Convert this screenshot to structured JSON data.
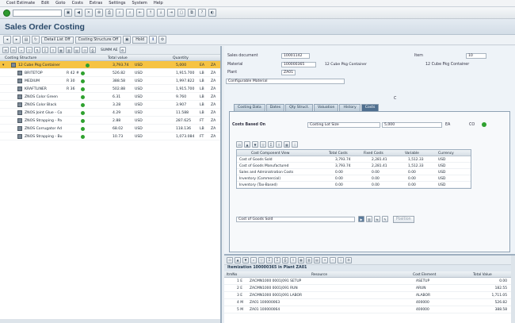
{
  "menu": [
    "Cost Estimate",
    "Edit",
    "Goto",
    "Costs",
    "Extras",
    "Settings",
    "System",
    "Help"
  ],
  "window_title": "Sales Order Costing",
  "app_buttons": {
    "detail_list_off": "Detail List Off",
    "costing_structure_off": "Costing Structure Off",
    "hold": "Hold"
  },
  "tree": {
    "summary_label": "SUMM AE",
    "headers": {
      "structure": "Costing Structure",
      "total_value": "Total value",
      "quantity": "Quantity"
    },
    "rows": [
      {
        "name": "12 Cube Pkg Container",
        "qty_prefix": "",
        "value": "3,793.74",
        "cur": "USD",
        "quantity": "5,000",
        "unit": "EA",
        "trail": "ZA",
        "selected": true
      },
      {
        "name": "BRITETOP",
        "qty_prefix": "R 42 #",
        "value": "526.82",
        "cur": "USD",
        "quantity": "1,915.700",
        "unit": "LB",
        "trail": "ZA",
        "selected": false
      },
      {
        "name": "MEDIUM",
        "qty_prefix": "R 30",
        "value": "388.58",
        "cur": "USD",
        "quantity": "1,997.822",
        "unit": "LB",
        "trail": "ZA",
        "selected": false
      },
      {
        "name": "KRAFTLINER",
        "qty_prefix": "R 36",
        "value": "502.88",
        "cur": "USD",
        "quantity": "1,915.700",
        "unit": "LB",
        "trail": "ZA",
        "selected": false
      },
      {
        "name": "ZNOS Color Green",
        "qty_prefix": "",
        "value": "6.31",
        "cur": "USD",
        "quantity": "9.760",
        "unit": "LB",
        "trail": "ZA",
        "selected": false
      },
      {
        "name": "ZNOS Color Black",
        "qty_prefix": "",
        "value": "3.28",
        "cur": "USD",
        "quantity": "3.907",
        "unit": "LB",
        "trail": "ZA",
        "selected": false
      },
      {
        "name": "ZNOS Joint Glue - Co",
        "qty_prefix": "",
        "value": "4.29",
        "cur": "USD",
        "quantity": "11.588",
        "unit": "LB",
        "trail": "ZA",
        "selected": false
      },
      {
        "name": "ZNOS Strapping - Pa",
        "qty_prefix": "",
        "value": "2.88",
        "cur": "USD",
        "quantity": "287.625",
        "unit": "FT",
        "trail": "ZA",
        "selected": false
      },
      {
        "name": "ZNOS Corrugator Ad",
        "qty_prefix": "",
        "value": "68.02",
        "cur": "USD",
        "quantity": "118.136",
        "unit": "LB",
        "trail": "ZA",
        "selected": false
      },
      {
        "name": "ZNOS Strapping - Bu",
        "qty_prefix": "",
        "value": "10.73",
        "cur": "USD",
        "quantity": "1,073.084",
        "unit": "FT",
        "trail": "ZA",
        "selected": false
      }
    ]
  },
  "header_fields": {
    "sales_document_label": "Sales document",
    "sales_document_value": "10001142",
    "item_label": "Item",
    "item_value": "10",
    "material_label": "Material",
    "material_value": "100000365",
    "material_desc": "12 Cube Pkg Container",
    "plant_label": "Plant",
    "plant_value": "ZA01",
    "configurable": "Configurable Material"
  },
  "tabs": [
    "Costing Data",
    "Dates",
    "Qty Struct.",
    "Valuation",
    "History",
    "Costs"
  ],
  "tab_marker": "C",
  "costs": {
    "based_on_label": "Costs Based On",
    "based_on_value": "Costing Lot Size",
    "lot_value": "5,000",
    "lot_unit": "EA",
    "currency_tag": "CO",
    "columns": [
      "Cost Component View",
      "Total Costs",
      "Fixed Costs",
      "Variable",
      "Currency"
    ],
    "rows": [
      {
        "view": "Cost of Goods Sold",
        "total": "3,793.74",
        "fixed": "2,281.41",
        "variable": "1,512.33",
        "currency": "USD"
      },
      {
        "view": "Cost of Goods Manufactured",
        "total": "3,793.74",
        "fixed": "2,281.41",
        "variable": "1,512.33",
        "currency": "USD"
      },
      {
        "view": "Sales and Administration Costs",
        "total": "0.00",
        "fixed": "0.00",
        "variable": "0.00",
        "currency": "USD"
      },
      {
        "view": "Inventory (Commercial)",
        "total": "0.00",
        "fixed": "0.00",
        "variable": "0.00",
        "currency": "USD"
      },
      {
        "view": "Inventory (Tax-Based)",
        "total": "0.00",
        "fixed": "0.00",
        "variable": "0.00",
        "currency": "USD"
      }
    ],
    "view_select": "Cost of Goods Sold",
    "position_label": "Position"
  },
  "itemization": {
    "caption": "Itemization 100000365 in Plant ZA01",
    "columns": [
      "ItmNo",
      "Resource",
      "Cost Element",
      "Total Value"
    ],
    "rows": [
      {
        "itm": "1 E",
        "resource": "ZACMN1000 0001|091 SETUP",
        "element": "ASETUP",
        "value": "0.00"
      },
      {
        "itm": "2 E",
        "resource": "ZACMN1000 0001|091 RUN",
        "element": "ARUN",
        "value": "182.55"
      },
      {
        "itm": "3 E",
        "resource": "ZACMN1000 0001|091 LABOR",
        "element": "ALABOR",
        "value": "1,711.05"
      },
      {
        "itm": "4 M",
        "resource": "ZA01 100000063",
        "element": "400000",
        "value": "526.82"
      },
      {
        "itm": "5 M",
        "resource": "ZA01 100000064",
        "element": "400000",
        "value": "388.58"
      }
    ]
  }
}
